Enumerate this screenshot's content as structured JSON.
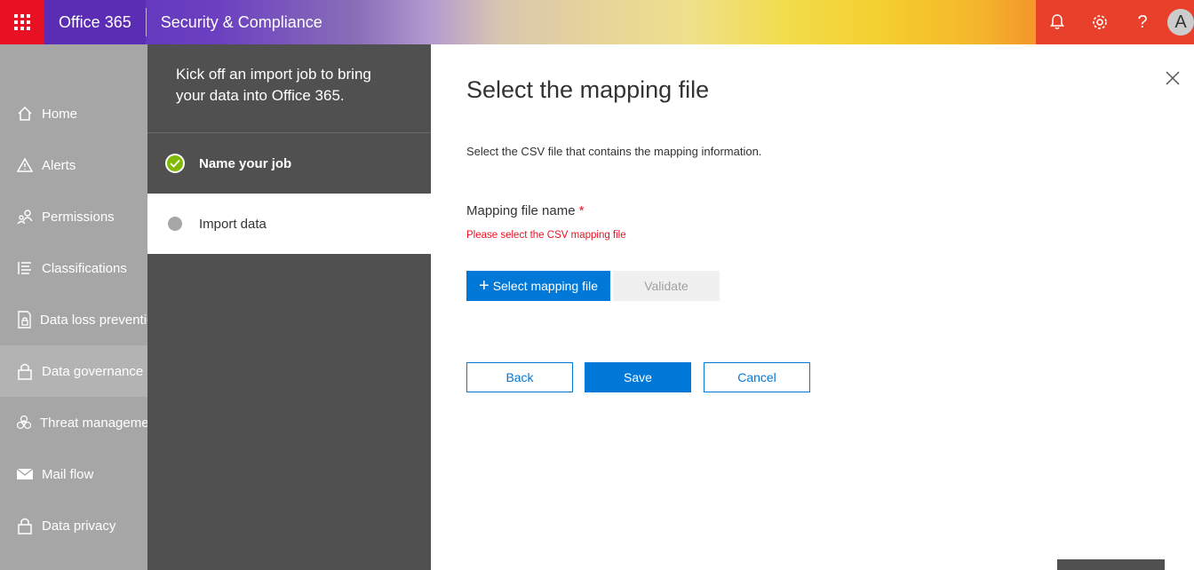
{
  "topbar": {
    "brand": "Office 365",
    "app_title": "Security & Compliance",
    "avatar_initial": "A",
    "icons": [
      "bell-icon",
      "gear-icon",
      "help-icon"
    ],
    "help_glyph": "?"
  },
  "leftnav": {
    "items": [
      {
        "label": "Home",
        "icon": "home-icon"
      },
      {
        "label": "Alerts",
        "icon": "alert-icon"
      },
      {
        "label": "Permissions",
        "icon": "people-icon"
      },
      {
        "label": "Classifications",
        "icon": "list-icon"
      },
      {
        "label": "Data loss prevention",
        "icon": "lock-document-icon"
      },
      {
        "label": "Data governance",
        "icon": "lock-icon"
      },
      {
        "label": "Threat management",
        "icon": "biohazard-icon"
      },
      {
        "label": "Mail flow",
        "icon": "mail-icon"
      },
      {
        "label": "Data privacy",
        "icon": "lock-icon"
      }
    ]
  },
  "wizard": {
    "header": "Kick off an import job to bring your data into Office 365.",
    "steps": [
      {
        "label": "Name your job",
        "status": "done"
      },
      {
        "label": "Import data",
        "status": "current"
      }
    ]
  },
  "main": {
    "title": "Select the mapping file",
    "description": "Select the CSV file that contains the mapping information.",
    "field_label": "Mapping file name",
    "required_mark": "*",
    "error": "Please select the CSV mapping file",
    "select_button": "Select mapping file",
    "plus_glyph": "+",
    "validate_button": "Validate",
    "back_button": "Back",
    "save_button": "Save",
    "cancel_button": "Cancel"
  },
  "colors": {
    "accent": "#0078d7",
    "error": "#e81123",
    "success": "#7fba00",
    "waffle": "#e81123"
  }
}
